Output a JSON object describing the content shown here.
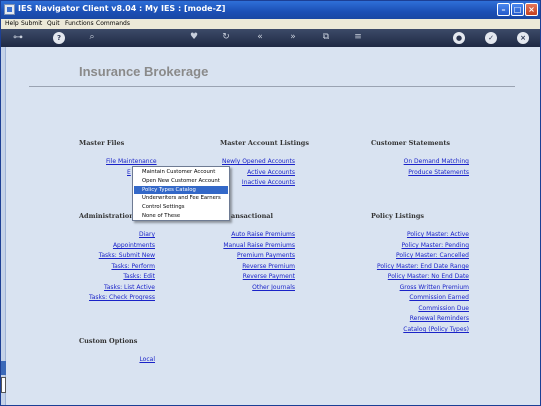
{
  "window": {
    "title": "IES Navigator Client v8.04 : My IES :      [mode-Z]"
  },
  "menu": [
    "Help",
    "Submit",
    "Quit",
    "Functions",
    "Commands"
  ],
  "toolbar_icons": [
    "key-icon",
    "help-icon",
    "search-icon",
    "heart-icon",
    "refresh-icon",
    "back-icon",
    "forward-icon",
    "copy-icon",
    "menu-icon",
    "chat-icon",
    "check-icon",
    "close-icon"
  ],
  "page": {
    "title": "Insurance Brokerage"
  },
  "sections": {
    "master_files": {
      "heading": "Master Files",
      "items": [
        "File Maintenance",
        "E"
      ]
    },
    "master_account_listings": {
      "heading": "Master Account Listings",
      "items": [
        "Newly Opened Accounts",
        "Active Accounts",
        "Inactive Accounts"
      ]
    },
    "customer_statements": {
      "heading": "Customer Statements",
      "items": [
        "On Demand Matching",
        "Produce Statements"
      ]
    },
    "administration": {
      "heading": "Administration",
      "items": [
        "Diary",
        "Appointments",
        "Tasks: Submit New",
        "Tasks: Perform",
        "Tasks: Edit",
        "Tasks: List Active",
        "Tasks: Check Progress"
      ]
    },
    "transactional": {
      "heading": "ansactional",
      "items": [
        "Auto Raise Premiums",
        "Manual Raise Premiums",
        "Premium Payments",
        "Reverse Premium",
        "Reverse Payment",
        "Other Journals"
      ]
    },
    "policy_listings": {
      "heading": "Policy Listings",
      "items": [
        "Policy Master: Active",
        "Policy Master: Pending",
        "Policy Master: Cancelled",
        "Policy Master: End Date Range",
        "Policy Master: No End Date",
        "Gross Written Premium",
        "Commission Earned",
        "Commission Due",
        "Renewal Reminders",
        "Catalog (Policy Types)"
      ]
    },
    "custom_options": {
      "heading": "Custom Options",
      "items": [
        "Local"
      ]
    }
  },
  "popup": {
    "items": [
      "Maintain Customer Account",
      "Open New Customer Account",
      "Policy Types Catalog",
      "Underwriters and Fee Earners",
      "Control Settings",
      "None of These"
    ],
    "selected_index": 2
  },
  "colors": {
    "link": "#1a23c8",
    "titlebar": "#1b4fb5",
    "content_bg": "#d9e3f1",
    "selection": "#3368c8"
  }
}
